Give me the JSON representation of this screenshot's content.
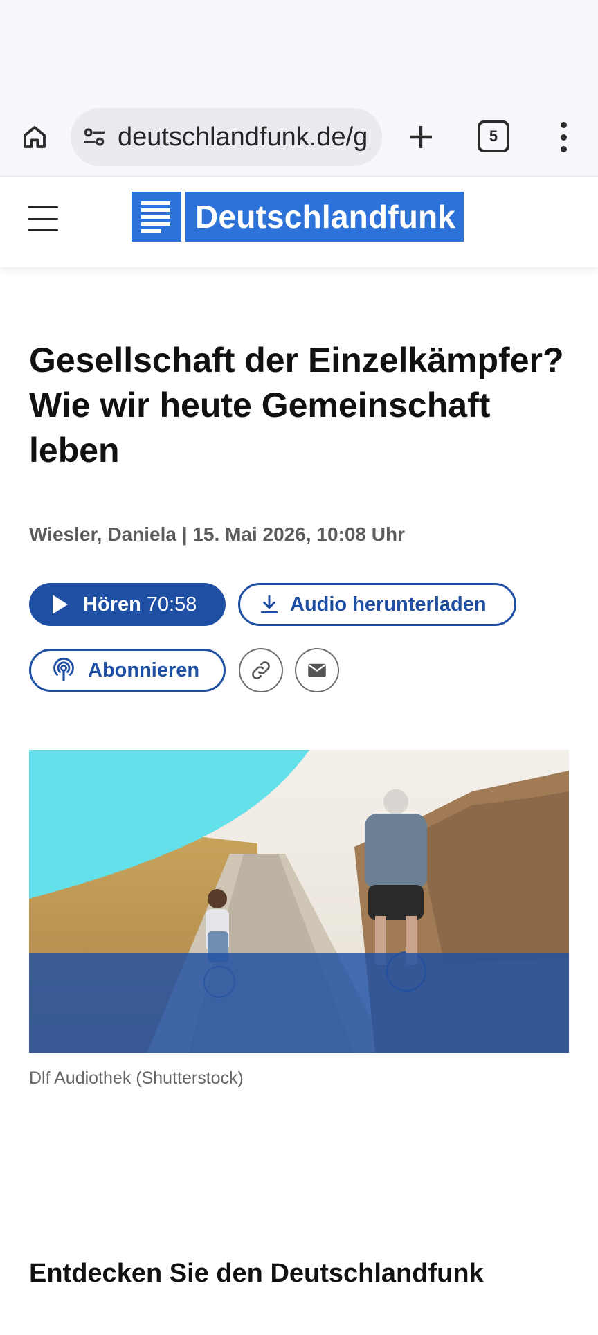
{
  "browser": {
    "url": "deutschlandfunk.de/g",
    "tab_count": "5"
  },
  "site": {
    "logo_text": "Deutschlandfunk",
    "brand_color": "#2d72d9"
  },
  "article": {
    "headline_lines": [
      "Gesellschaft der Einzelkämpfer?",
      "Wie wir heute Gemeinschaft",
      "leben"
    ],
    "meta": "Wiesler, Daniela | 15. Mai 2026, 10:08 Uhr",
    "listen_label": "Hören",
    "listen_duration": "70:58",
    "download_label": "Audio herunterladen",
    "subscribe_label": "Abonnieren",
    "image_caption": "Dlf Audiothek (Shutterstock)"
  },
  "discover": {
    "title": "Entdecken Sie den Deutschlandfunk"
  },
  "icons": {
    "home": "home-icon",
    "site_settings": "tune-icon",
    "new_tab": "plus-icon",
    "more": "more-vert-icon",
    "menu": "hamburger-icon",
    "play": "play-icon",
    "download": "download-icon",
    "podcast": "podcast-icon",
    "link": "link-icon",
    "mail": "mail-icon"
  },
  "colors": {
    "primary": "#1f4fa3",
    "accent_cyan": "#63e0ea"
  }
}
